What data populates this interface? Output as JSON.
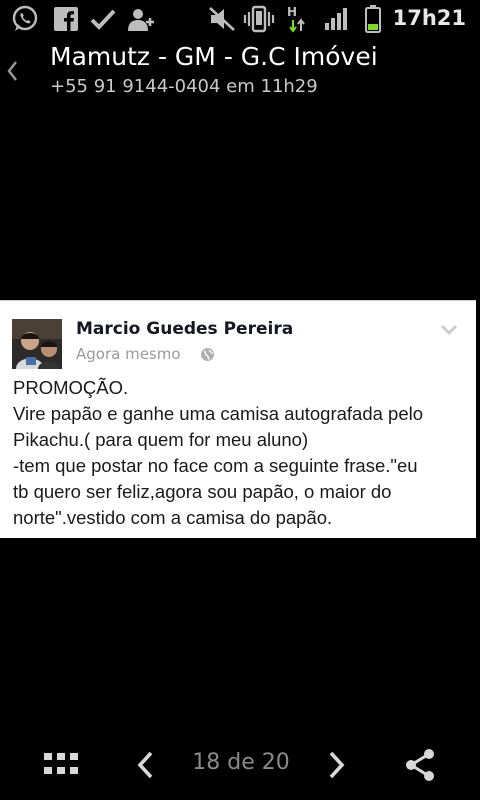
{
  "status_bar": {
    "time": "17h21",
    "icons": [
      "whatsapp-icon",
      "facebook-icon",
      "check-icon",
      "add-contact-icon",
      "mute-icon",
      "vibrate-icon",
      "hspa-data-icon",
      "signal-icon",
      "battery-icon"
    ],
    "data_type": "H"
  },
  "header": {
    "title": "Mamutz - GM - G.C Imóvei",
    "subtitle": "+55 91 9144-0404 em 11h29"
  },
  "post": {
    "author": "Marcio Guedes Pereira",
    "time": "Agora mesmo",
    "body_lines": [
      "PROMOÇÃO.",
      "Vire papão e ganhe uma camisa autografada pelo",
      "Pikachu.( para quem for meu aluno)",
      "-tem que postar no face com a seguinte frase.\"eu",
      "tb quero ser feliz,agora sou papão, o maior do",
      "norte\".vestido com a camisa do papão."
    ]
  },
  "bottom_bar": {
    "page_counter": "18 de 20"
  },
  "colors": {
    "background": "#000000",
    "card": "#ffffff",
    "battery_green": "#7bd72a",
    "counter_gray": "#8a8a8a"
  }
}
